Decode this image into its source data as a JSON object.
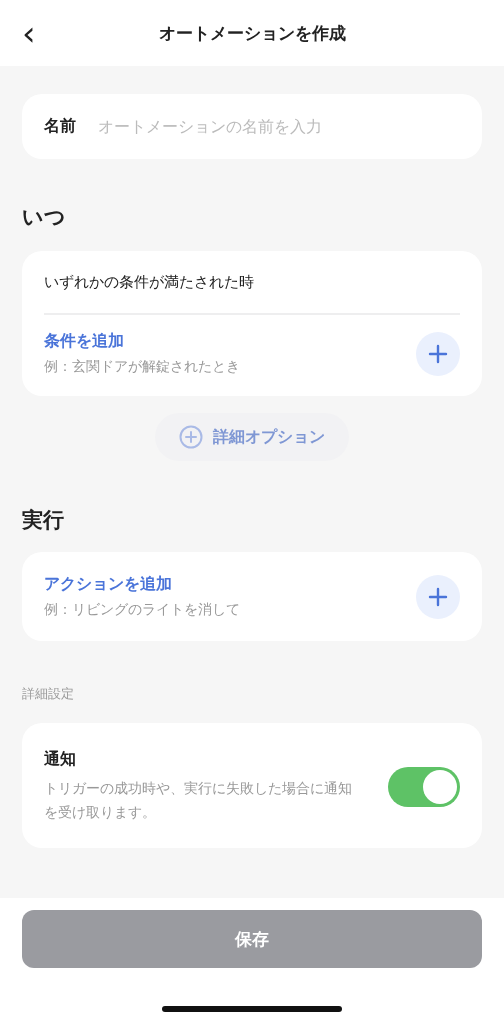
{
  "header": {
    "back_icon": "‹",
    "title": "オートメーションを作成"
  },
  "name_field": {
    "label": "名前",
    "placeholder": "オートメーションの名前を入力"
  },
  "when": {
    "heading": "いつ",
    "condition_mode": "いずれかの条件が満たされた時",
    "add_item": {
      "title": "条件を追加",
      "example": "例：玄関ドアが解錠されたとき"
    },
    "detail_options": {
      "label": "詳細オプション",
      "disabled": true
    }
  },
  "execute": {
    "heading": "実行",
    "add_item": {
      "title": "アクションを追加",
      "example": "例：リビングのライトを消して"
    }
  },
  "advanced": {
    "heading": "詳細設定",
    "settings": [
      {
        "kind": "toggle",
        "title": "通知",
        "description": "トリガーの成功時や、実行に失敗した場合に通知を受け取ります。",
        "on": true
      }
    ]
  },
  "save_button": {
    "label": "保存",
    "disabled": true
  }
}
